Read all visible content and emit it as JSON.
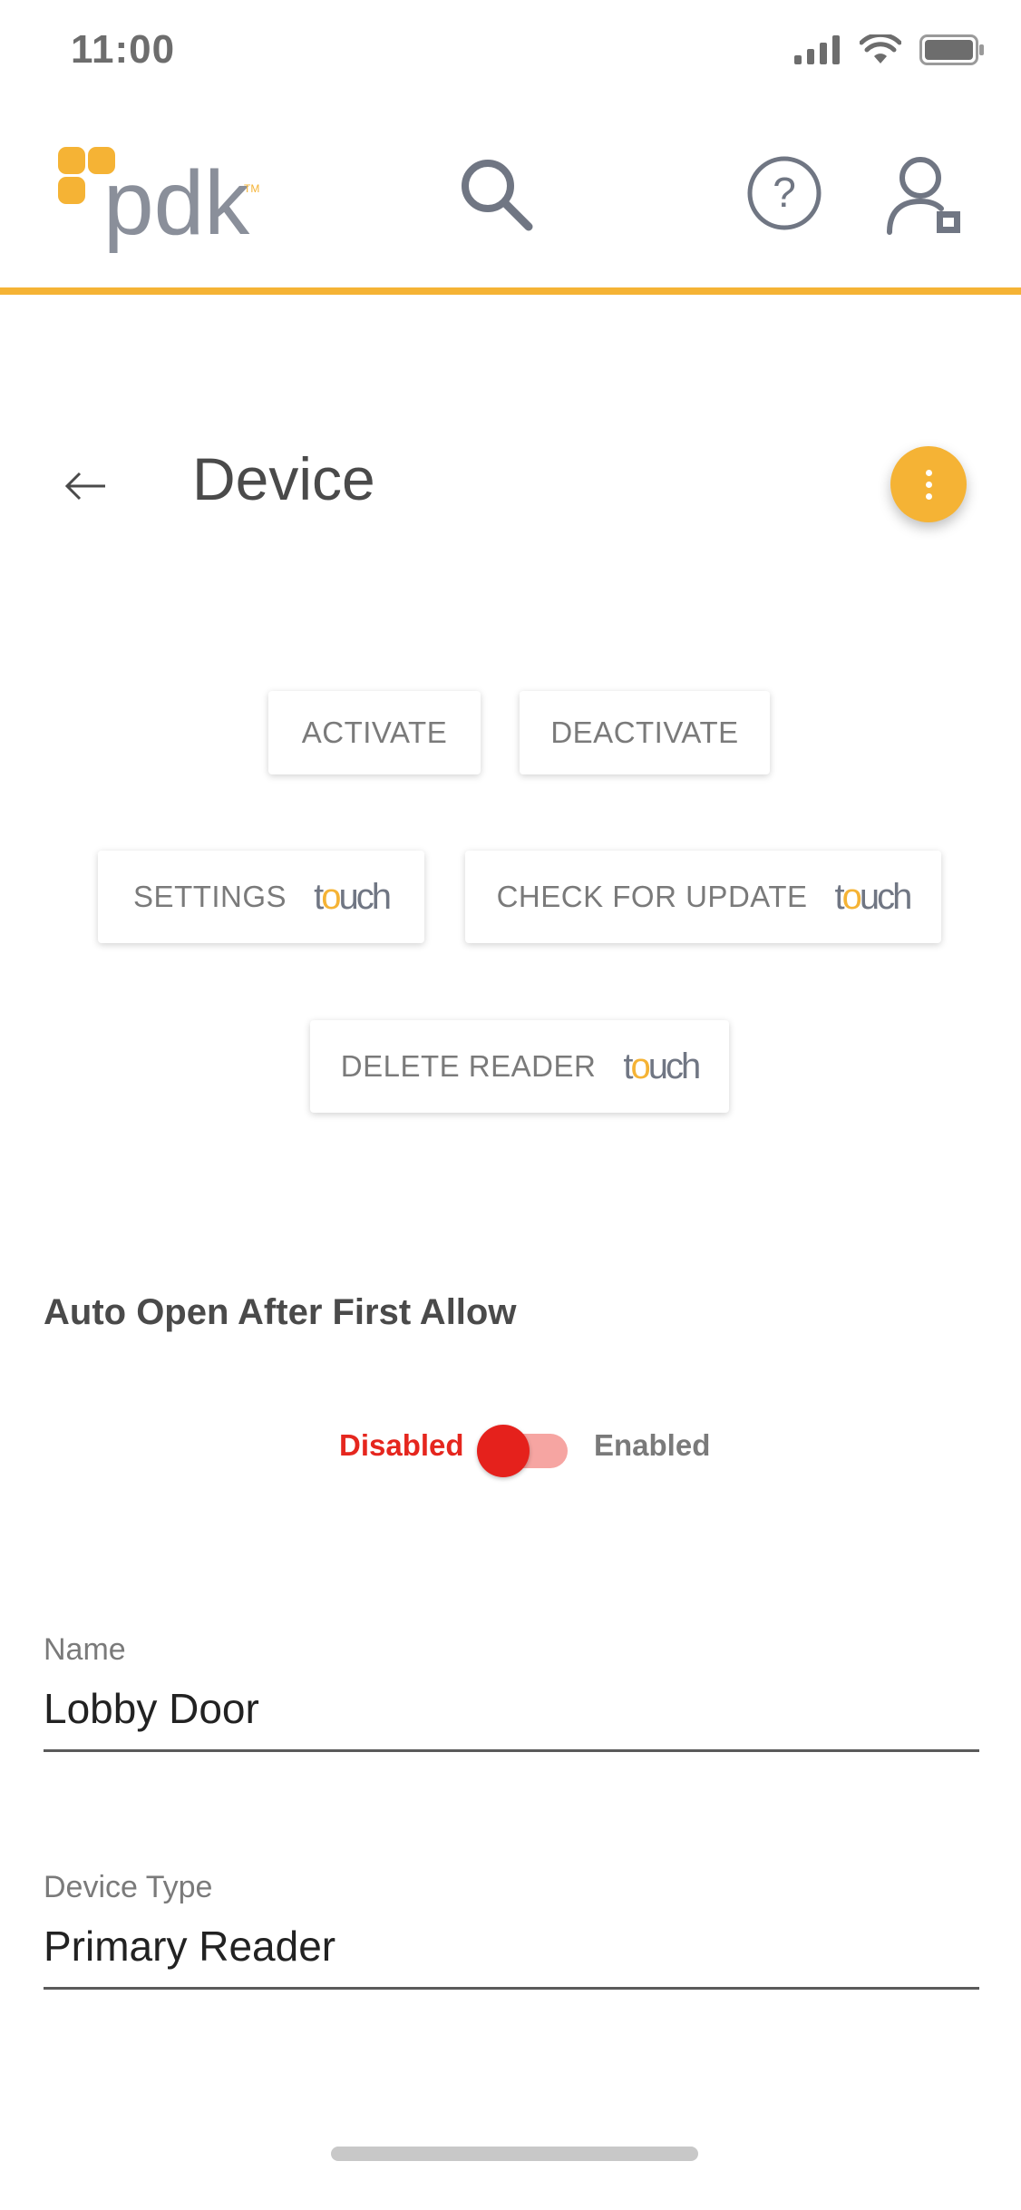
{
  "status_bar": {
    "time": "11:00"
  },
  "header": {
    "logo_text": "pdk",
    "icons": [
      "search-icon",
      "help-icon",
      "account-lock-icon"
    ]
  },
  "page": {
    "title": "Device",
    "back_icon": "arrow-left-icon",
    "menu_icon": "more-vertical-icon"
  },
  "actions": {
    "activate": "ACTIVATE",
    "deactivate": "DEACTIVATE",
    "settings": "SETTINGS",
    "check_update": "CHECK FOR UPDATE",
    "delete_reader": "DELETE READER",
    "touch_badge": "touch"
  },
  "auto_open": {
    "label": "Auto Open After First Allow",
    "off_label": "Disabled",
    "on_label": "Enabled",
    "enabled": false
  },
  "fields": {
    "name": {
      "label": "Name",
      "value": "Lobby Door"
    },
    "device_type": {
      "label": "Device Type",
      "value": "Primary Reader"
    }
  },
  "colors": {
    "accent": "#f5b335",
    "toggle_off": "#e5211c",
    "icon_gray": "#707683"
  }
}
